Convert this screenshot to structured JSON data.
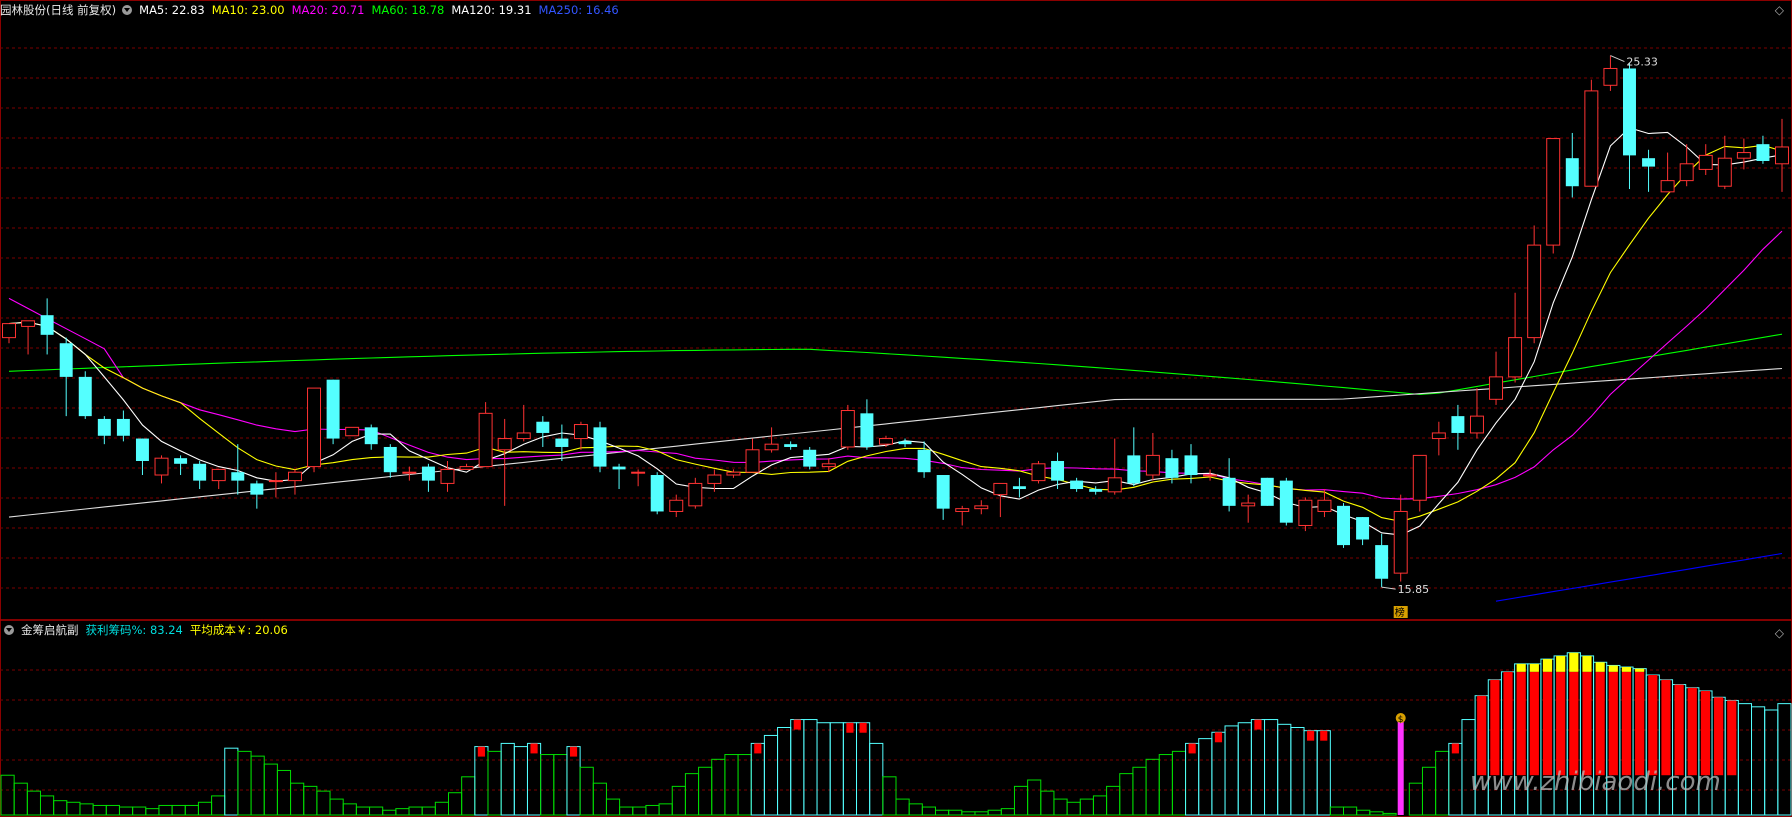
{
  "main_header": {
    "stock_name": "园林股份(日线 前复权)",
    "ma5": "MA5: 22.83",
    "ma10": "MA10: 23.00",
    "ma20": "MA20: 20.71",
    "ma60": "MA60: 18.78",
    "ma120": "MA120: 19.31",
    "ma250": "MA250: 16.46"
  },
  "sub_header": {
    "indicator": "金筹启航副",
    "profit_chips": "获利筹码%: 83.24",
    "avg_cost": "平均成本￥: 20.06"
  },
  "annotations": {
    "high_label": "25.33",
    "low_label": "15.85",
    "list_badge": "榜",
    "dollar_badge": "$"
  },
  "watermark": "www.zhibiaodi.com",
  "colors": {
    "background": "#000000",
    "up": "#ff3333",
    "down": "#54ffff",
    "ma5": "#ffffff",
    "ma10": "#ffff00",
    "ma20": "#ff00ff",
    "ma60": "#00ff00",
    "ma120": "#ffffff",
    "ma250": "#0000ff",
    "grid": "#7a0000"
  },
  "chart_data": [
    {
      "type": "candlestick",
      "title": "园林股份(日线 前复权)",
      "ylim": [
        15.3,
        26.0
      ],
      "grid": true,
      "series_names": [
        "MA5",
        "MA10",
        "MA20",
        "MA60",
        "MA120",
        "MA250"
      ],
      "candles": [
        [
          20.3,
          20.55,
          20.5,
          20.2
        ],
        [
          20.5,
          20.6,
          20.6,
          20.0
        ],
        [
          20.7,
          20.35,
          21.0,
          20.0
        ],
        [
          20.2,
          19.6,
          20.3,
          18.9
        ],
        [
          19.6,
          18.9,
          19.7,
          18.85
        ],
        [
          18.85,
          18.55,
          18.9,
          18.4
        ],
        [
          18.85,
          18.55,
          19.0,
          18.45
        ],
        [
          18.5,
          18.1,
          18.5,
          17.85
        ],
        [
          17.85,
          18.15,
          18.2,
          17.7
        ],
        [
          18.15,
          18.05,
          18.2,
          17.85
        ],
        [
          18.05,
          17.75,
          18.1,
          17.6
        ],
        [
          17.75,
          17.95,
          17.95,
          17.6
        ],
        [
          17.9,
          17.75,
          18.4,
          17.5
        ],
        [
          17.7,
          17.5,
          17.75,
          17.25
        ],
        [
          17.75,
          17.75,
          17.9,
          17.45
        ],
        [
          17.75,
          17.9,
          17.95,
          17.5
        ],
        [
          18.0,
          19.4,
          19.4,
          17.9
        ],
        [
          19.55,
          18.5,
          19.55,
          18.4
        ],
        [
          18.55,
          18.7,
          18.7,
          18.55
        ],
        [
          18.7,
          18.4,
          18.75,
          18.3
        ],
        [
          18.35,
          17.9,
          18.4,
          17.8
        ],
        [
          17.9,
          17.9,
          18.0,
          17.75
        ],
        [
          18.0,
          17.75,
          18.05,
          17.55
        ],
        [
          17.7,
          17.95,
          18.1,
          17.55
        ],
        [
          17.95,
          18.0,
          18.05,
          17.95
        ],
        [
          18.0,
          18.95,
          19.15,
          18.0
        ],
        [
          18.3,
          18.5,
          18.85,
          17.3
        ],
        [
          18.5,
          18.6,
          19.1,
          18.45
        ],
        [
          18.8,
          18.6,
          18.9,
          18.35
        ],
        [
          18.5,
          18.35,
          18.75,
          18.1
        ],
        [
          18.5,
          18.75,
          18.8,
          18.3
        ],
        [
          18.7,
          18.0,
          18.8,
          17.9
        ],
        [
          18.0,
          17.95,
          18.05,
          17.6
        ],
        [
          17.9,
          17.9,
          17.95,
          17.65
        ],
        [
          17.85,
          17.2,
          17.9,
          17.15
        ],
        [
          17.2,
          17.4,
          17.5,
          17.1
        ],
        [
          17.3,
          17.7,
          17.8,
          17.25
        ],
        [
          17.7,
          17.85,
          17.95,
          17.55
        ],
        [
          17.85,
          17.9,
          17.95,
          17.8
        ],
        [
          17.9,
          18.3,
          18.5,
          17.9
        ],
        [
          18.3,
          18.4,
          18.7,
          18.25
        ],
        [
          18.4,
          18.35,
          18.45,
          18.3
        ],
        [
          18.3,
          18.0,
          18.35,
          17.95
        ],
        [
          18.0,
          18.05,
          18.15,
          17.9
        ],
        [
          18.35,
          19.0,
          19.1,
          18.3
        ],
        [
          18.95,
          18.35,
          19.2,
          18.3
        ],
        [
          18.4,
          18.5,
          18.55,
          18.35
        ],
        [
          18.45,
          18.4,
          18.5,
          18.35
        ],
        [
          18.3,
          17.9,
          18.45,
          17.8
        ],
        [
          17.85,
          17.25,
          17.85,
          17.05
        ],
        [
          17.2,
          17.25,
          17.3,
          16.95
        ],
        [
          17.25,
          17.3,
          17.4,
          17.15
        ],
        [
          17.5,
          17.7,
          17.7,
          17.1
        ],
        [
          17.65,
          17.6,
          17.8,
          17.45
        ],
        [
          17.75,
          18.05,
          18.1,
          17.7
        ],
        [
          18.1,
          17.75,
          18.25,
          17.6
        ],
        [
          17.75,
          17.6,
          17.8,
          17.55
        ],
        [
          17.6,
          17.55,
          17.65,
          17.5
        ],
        [
          17.55,
          17.8,
          18.5,
          17.5
        ],
        [
          18.2,
          17.7,
          18.7,
          17.65
        ],
        [
          17.85,
          18.2,
          18.6,
          17.75
        ],
        [
          18.15,
          17.8,
          18.3,
          17.7
        ],
        [
          18.2,
          17.85,
          18.4,
          17.7
        ],
        [
          17.85,
          17.85,
          17.95,
          17.75
        ],
        [
          17.8,
          17.3,
          18.15,
          17.2
        ],
        [
          17.3,
          17.35,
          17.5,
          17.0
        ],
        [
          17.8,
          17.3,
          17.8,
          17.3
        ],
        [
          17.75,
          17.0,
          17.8,
          16.95
        ],
        [
          16.95,
          17.4,
          17.45,
          16.85
        ],
        [
          17.2,
          17.4,
          17.6,
          17.1
        ],
        [
          17.3,
          16.6,
          17.35,
          16.55
        ],
        [
          17.1,
          16.7,
          17.1,
          16.6
        ],
        [
          16.6,
          16.0,
          16.8,
          15.85
        ],
        [
          16.1,
          17.2,
          17.5,
          15.95
        ],
        [
          17.4,
          18.2,
          18.2,
          17.2
        ],
        [
          18.5,
          18.6,
          18.8,
          18.2
        ],
        [
          18.9,
          18.6,
          19.1,
          18.3
        ],
        [
          18.6,
          18.9,
          19.4,
          18.5
        ],
        [
          19.2,
          19.6,
          20.05,
          19.1
        ],
        [
          19.6,
          20.3,
          21.1,
          19.5
        ],
        [
          20.3,
          21.95,
          22.3,
          20.2
        ],
        [
          21.95,
          23.85,
          23.85,
          21.8
        ],
        [
          23.5,
          23.0,
          23.95,
          22.8
        ],
        [
          23.0,
          24.7,
          24.9,
          23.0
        ],
        [
          24.8,
          25.1,
          25.33,
          24.7
        ],
        [
          25.1,
          23.55,
          25.2,
          22.95
        ],
        [
          23.5,
          23.35,
          23.65,
          22.9
        ],
        [
          22.9,
          23.1,
          23.6,
          22.95
        ],
        [
          23.1,
          23.4,
          23.75,
          23.0
        ],
        [
          23.3,
          23.55,
          23.75,
          23.2
        ],
        [
          23.0,
          23.5,
          23.9,
          22.95
        ],
        [
          23.5,
          23.6,
          23.85,
          23.3
        ],
        [
          23.75,
          23.45,
          23.9,
          23.4
        ],
        [
          23.4,
          23.7,
          24.2,
          22.9
        ]
      ]
    },
    {
      "type": "bar",
      "title": "金筹启航副",
      "series_names": [
        "获利筹码%",
        "平均成本￥"
      ],
      "values": [
        25,
        20,
        15,
        12,
        9,
        8,
        7,
        6,
        6,
        5,
        5,
        4,
        6,
        6,
        6,
        8,
        12,
        42,
        40,
        37,
        32,
        28,
        20,
        18,
        15,
        10,
        7,
        5,
        5,
        3,
        4,
        5,
        5,
        8,
        14,
        24,
        43,
        40,
        45,
        43,
        45,
        38,
        38,
        43,
        30,
        20,
        10,
        5,
        5,
        6,
        7,
        18,
        26,
        30,
        35,
        38,
        38,
        45,
        50,
        55,
        60,
        60,
        58,
        58,
        58,
        58,
        45,
        24,
        10,
        7,
        5,
        3,
        3,
        2,
        2,
        3,
        4,
        18,
        22,
        15,
        10,
        8,
        10,
        12,
        18,
        26,
        30,
        35,
        38,
        40,
        45,
        48,
        52,
        56,
        58,
        60,
        60,
        57,
        55,
        53,
        53,
        5,
        5,
        3,
        2,
        1,
        0,
        20,
        30,
        40,
        45,
        60,
        75,
        85,
        90,
        95,
        95,
        98,
        100,
        102,
        100,
        96,
        94,
        93,
        92,
        88,
        85,
        82,
        80,
        78,
        74,
        72,
        70,
        68,
        66,
        70
      ]
    }
  ]
}
